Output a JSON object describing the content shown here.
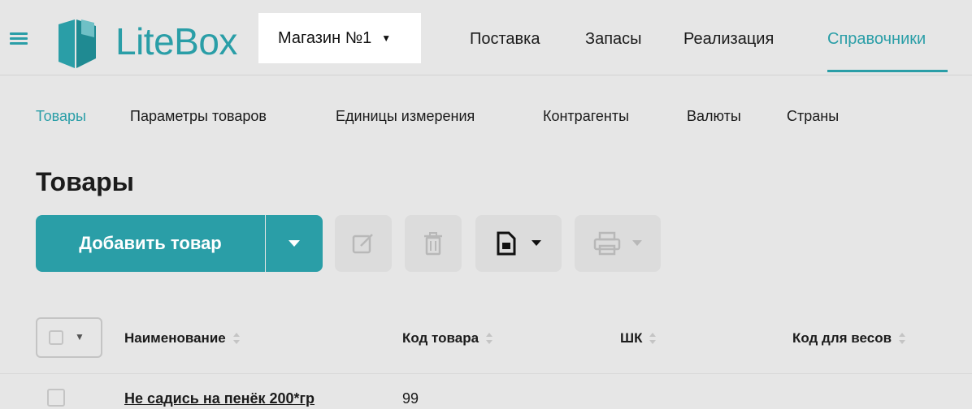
{
  "app": {
    "logo_text": "LiteBox",
    "store_selector": "Магазин №1",
    "brand_color": "#2a9ea7"
  },
  "main_nav": [
    {
      "label": "Поставка",
      "active": false
    },
    {
      "label": "Запасы",
      "active": false
    },
    {
      "label": "Реализация",
      "active": false
    },
    {
      "label": "Справочники",
      "active": true
    }
  ],
  "sub_nav": [
    {
      "label": "Товары",
      "active": true
    },
    {
      "label": "Параметры товаров",
      "active": false
    },
    {
      "label": "Единицы измерения",
      "active": false
    },
    {
      "label": "Контрагенты",
      "active": false
    },
    {
      "label": "Валюты",
      "active": false
    },
    {
      "label": "Страны",
      "active": false
    }
  ],
  "page_title": "Товары",
  "toolbar": {
    "add_label": "Добавить товар",
    "icons": [
      "chevron-down-icon",
      "edit-icon",
      "trash-icon",
      "document-icon",
      "print-icon"
    ]
  },
  "table": {
    "columns": [
      "Наименование",
      "Код товара",
      "ШК",
      "Код для весов"
    ],
    "rows": [
      {
        "name": "Не садись на пенёк 200*гр",
        "code": "99",
        "barcode": "",
        "weight_code": ""
      }
    ]
  }
}
